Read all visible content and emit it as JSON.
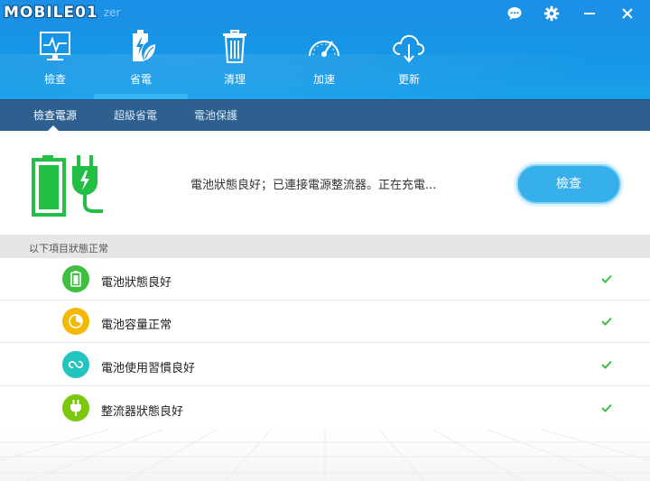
{
  "header": {
    "brand": "MOBILE01",
    "app_title": "zer",
    "nav": [
      {
        "label": "檢查",
        "icon": "monitor-pulse-icon"
      },
      {
        "label": "省電",
        "icon": "battery-leaf-icon"
      },
      {
        "label": "清理",
        "icon": "trash-icon"
      },
      {
        "label": "加速",
        "icon": "speedometer-icon"
      },
      {
        "label": "更新",
        "icon": "cloud-download-icon"
      }
    ],
    "active_nav": "省電",
    "controls": [
      "chat-icon",
      "gear-icon",
      "minimize-icon",
      "close-icon"
    ]
  },
  "subtabs": [
    "檢查電源",
    "超級省電",
    "電池保護"
  ],
  "active_subtab": "檢查電源",
  "status": {
    "message": "電池狀態良好；已連接電源整流器。正在充電...",
    "button_label": "檢查"
  },
  "section_title": "以下項目狀態正常",
  "items": [
    {
      "label": "電池狀態良好",
      "icon": "battery-icon",
      "color": "#3fbf3f"
    },
    {
      "label": "電池容量正常",
      "icon": "pie-chart-icon",
      "color": "#f5b800"
    },
    {
      "label": "電池使用習慣良好",
      "icon": "cycle-icon",
      "color": "#22c4c0"
    },
    {
      "label": "整流器狀態良好",
      "icon": "plug-icon",
      "color": "#7ac70c"
    }
  ],
  "colors": {
    "header": "#1b8fe6",
    "subtab_bar": "#2d5f8f",
    "accent": "#35b0ea",
    "success": "#3fbf3f"
  }
}
